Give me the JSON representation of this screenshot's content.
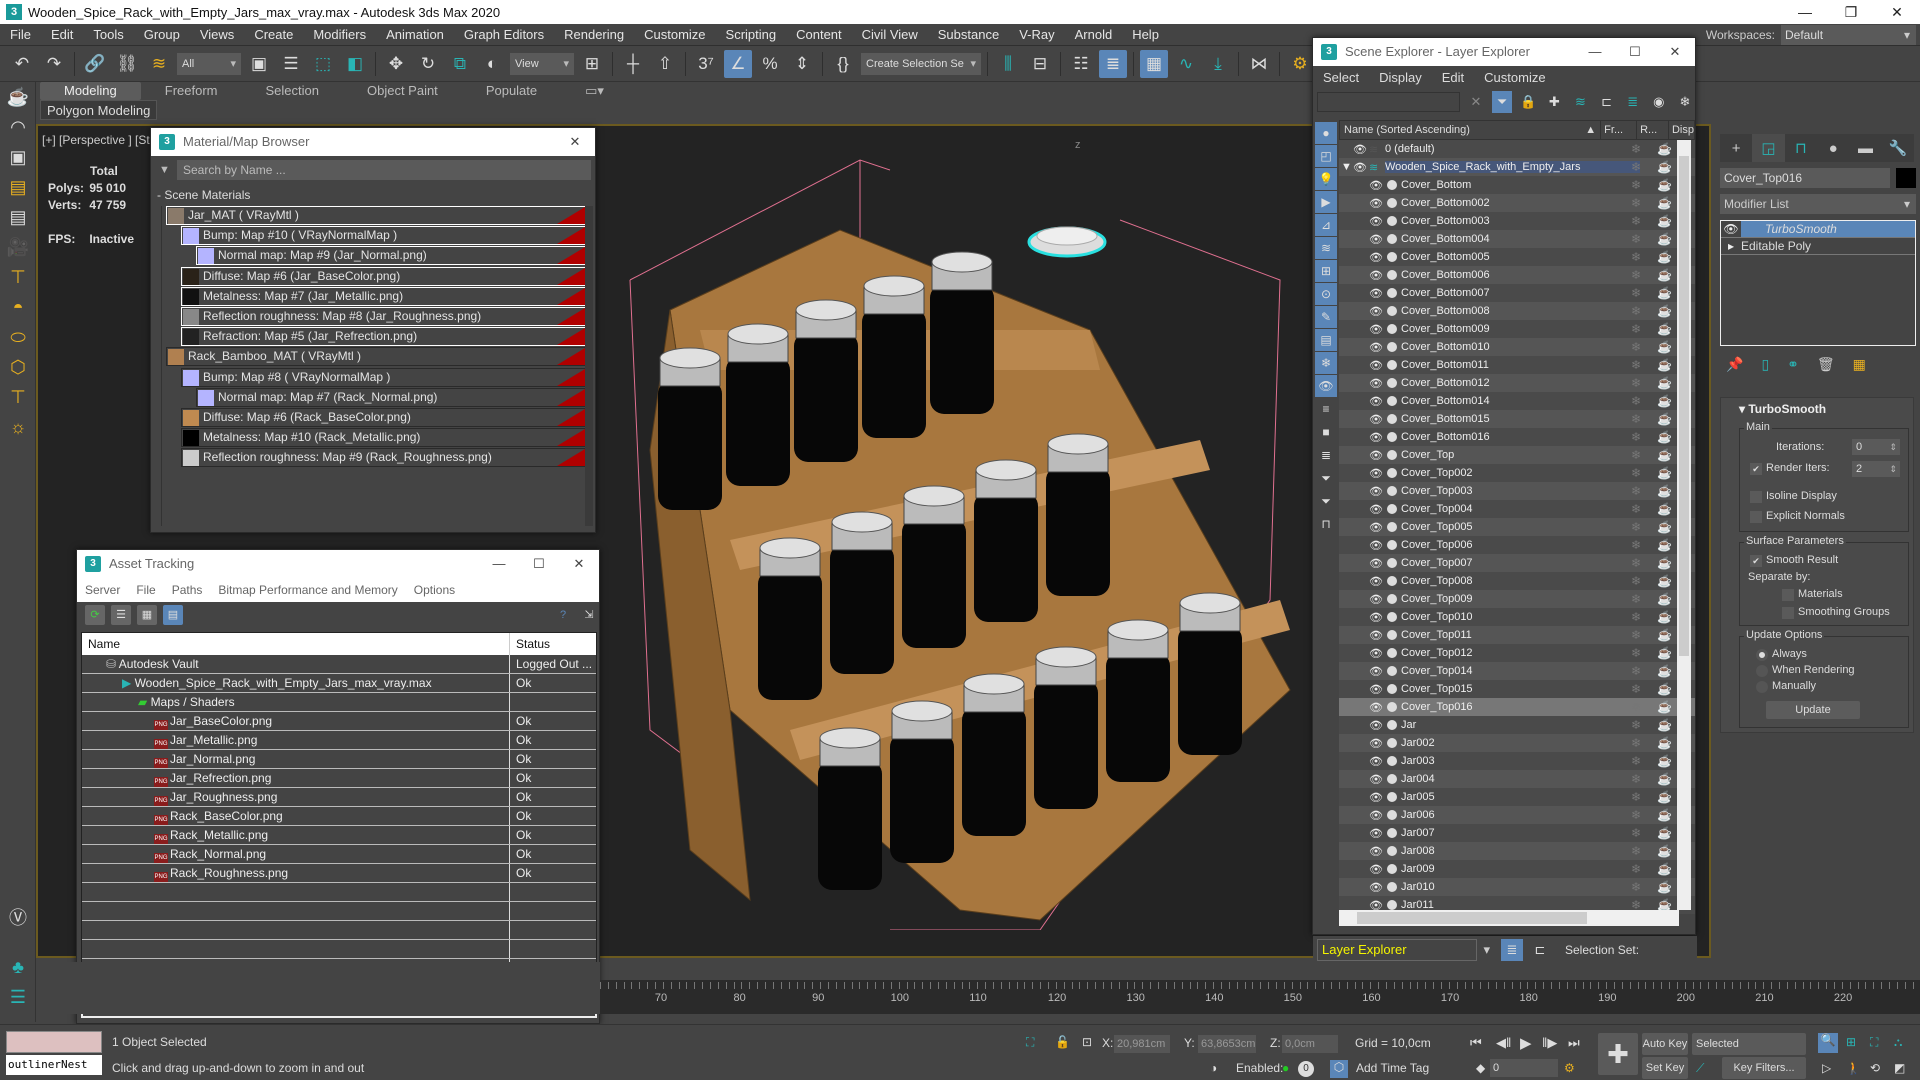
{
  "window": {
    "title": "Wooden_Spice_Rack_with_Empty_Jars_max_vray.max - Autodesk 3ds Max 2020",
    "minimize": "—",
    "restore": "❐",
    "close": "✕"
  },
  "menubar": [
    "File",
    "Edit",
    "Tools",
    "Group",
    "Views",
    "Create",
    "Modifiers",
    "Animation",
    "Graph Editors",
    "Rendering",
    "Customize",
    "Scripting",
    "Content",
    "Civil View",
    "Substance",
    "V-Ray",
    "Arnold",
    "Help"
  ],
  "workspaces": {
    "label": "Workspaces:",
    "value": "Default"
  },
  "toolbar": {
    "selection_filter": "All",
    "ref_coord": "View",
    "named_selection": "Create Selection Se"
  },
  "ribbon": {
    "tabs": [
      "Modeling",
      "Freeform",
      "Selection",
      "Object Paint",
      "Populate"
    ],
    "active_tab": "Modeling",
    "panel": "Polygon Modeling"
  },
  "viewport": {
    "label": "[+] [Perspective ] [St",
    "stats": {
      "total_label": "Total",
      "polys_label": "Polys:",
      "polys": "95 010",
      "verts_label": "Verts:",
      "verts": "47 759",
      "fps_label": "FPS:",
      "fps": "Inactive"
    },
    "axis_label": "z"
  },
  "material_browser": {
    "title": "Material/Map Browser",
    "search_placeholder": "Search by Name ...",
    "section": "- Scene Materials",
    "items": [
      {
        "text": "Jar_MAT  ( VRayMtl )",
        "level": 0,
        "swatch": "#8a7a6a",
        "highlight": true
      },
      {
        "text": "Bump: Map #10  ( VRayNormalMap )",
        "level": 1,
        "swatch": "#b4b4ff",
        "highlight": true
      },
      {
        "text": "Normal map: Map #9 (Jar_Normal.png)",
        "level": 2,
        "swatch": "#b4b4ff",
        "highlight": true
      },
      {
        "text": "Diffuse: Map #6 (Jar_BaseColor.png)",
        "level": 1,
        "swatch": "#2a2218",
        "highlight": true
      },
      {
        "text": "Metalness: Map #7 (Jar_Metallic.png)",
        "level": 1,
        "swatch": "#111111",
        "highlight": true
      },
      {
        "text": "Reflection roughness: Map #8 (Jar_Roughness.png)",
        "level": 1,
        "swatch": "#888888",
        "highlight": true
      },
      {
        "text": "Refraction: Map #5 (Jar_Refrection.png)",
        "level": 1,
        "swatch": "#222222",
        "highlight": true
      },
      {
        "text": "Rack_Bamboo_MAT  ( VRayMtl )",
        "level": 0,
        "swatch": "#b08050",
        "highlight": false
      },
      {
        "text": "Bump: Map #8  ( VRayNormalMap )",
        "level": 1,
        "swatch": "#b4b4ff",
        "highlight": false
      },
      {
        "text": "Normal map: Map #7 (Rack_Normal.png)",
        "level": 2,
        "swatch": "#b4b4ff",
        "highlight": false
      },
      {
        "text": "Diffuse: Map #6 (Rack_BaseColor.png)",
        "level": 1,
        "swatch": "#c08a50",
        "highlight": false
      },
      {
        "text": "Metalness: Map #10 (Rack_Metallic.png)",
        "level": 1,
        "swatch": "#000000",
        "highlight": false
      },
      {
        "text": "Reflection roughness: Map #9 (Rack_Roughness.png)",
        "level": 1,
        "swatch": "#cccccc",
        "highlight": false
      }
    ]
  },
  "asset_tracking": {
    "title": "Asset Tracking",
    "menu": [
      "Server",
      "File",
      "Paths",
      "Bitmap Performance and Memory",
      "Options"
    ],
    "columns": [
      "Name",
      "Status"
    ],
    "rows": [
      {
        "name": "Autodesk Vault",
        "status": "Logged Out ...",
        "level": 0,
        "icon": "vault"
      },
      {
        "name": "Wooden_Spice_Rack_with_Empty_Jars_max_vray.max",
        "status": "Ok",
        "level": 1,
        "icon": "max"
      },
      {
        "name": "Maps / Shaders",
        "status": "",
        "level": 2,
        "icon": "maps"
      },
      {
        "name": "Jar_BaseColor.png",
        "status": "Ok",
        "level": 3,
        "icon": "png"
      },
      {
        "name": "Jar_Metallic.png",
        "status": "Ok",
        "level": 3,
        "icon": "png"
      },
      {
        "name": "Jar_Normal.png",
        "status": "Ok",
        "level": 3,
        "icon": "png"
      },
      {
        "name": "Jar_Refrection.png",
        "status": "Ok",
        "level": 3,
        "icon": "png"
      },
      {
        "name": "Jar_Roughness.png",
        "status": "Ok",
        "level": 3,
        "icon": "png"
      },
      {
        "name": "Rack_BaseColor.png",
        "status": "Ok",
        "level": 3,
        "icon": "png"
      },
      {
        "name": "Rack_Metallic.png",
        "status": "Ok",
        "level": 3,
        "icon": "png"
      },
      {
        "name": "Rack_Normal.png",
        "status": "Ok",
        "level": 3,
        "icon": "png"
      },
      {
        "name": "Rack_Roughness.png",
        "status": "Ok",
        "level": 3,
        "icon": "png"
      }
    ],
    "png_badge": "PNG"
  },
  "scene_explorer": {
    "title": "Scene Explorer - Layer Explorer",
    "menu": [
      "Select",
      "Display",
      "Edit",
      "Customize"
    ],
    "columns": {
      "name": "Name (Sorted Ascending)",
      "frozen": "Fr...",
      "render": "R...",
      "display": "Disp"
    },
    "layers": [
      {
        "name": "0 (default)"
      },
      {
        "name": "Wooden_Spice_Rack_with_Empty_Jars"
      }
    ],
    "objects": [
      "Cover_Bottom",
      "Cover_Bottom002",
      "Cover_Bottom003",
      "Cover_Bottom004",
      "Cover_Bottom005",
      "Cover_Bottom006",
      "Cover_Bottom007",
      "Cover_Bottom008",
      "Cover_Bottom009",
      "Cover_Bottom010",
      "Cover_Bottom011",
      "Cover_Bottom012",
      "Cover_Bottom014",
      "Cover_Bottom015",
      "Cover_Bottom016",
      "Cover_Top",
      "Cover_Top002",
      "Cover_Top003",
      "Cover_Top004",
      "Cover_Top005",
      "Cover_Top006",
      "Cover_Top007",
      "Cover_Top008",
      "Cover_Top009",
      "Cover_Top010",
      "Cover_Top011",
      "Cover_Top012",
      "Cover_Top014",
      "Cover_Top015",
      "Cover_Top016",
      "Jar",
      "Jar002",
      "Jar003",
      "Jar004",
      "Jar005",
      "Jar006",
      "Jar007",
      "Jar008",
      "Jar009",
      "Jar010",
      "Jar011"
    ],
    "selected_object": "Cover_Top016",
    "footer": {
      "explorer": "Layer Explorer",
      "selection_set_label": "Selection Set:"
    }
  },
  "command_panel": {
    "object_name": "Cover_Top016",
    "modifier_list": "Modifier List",
    "stack": [
      {
        "name": "TurboSmooth",
        "selected": true
      },
      {
        "name": "Editable Poly",
        "selected": false
      }
    ],
    "rollout": {
      "title": "TurboSmooth",
      "main_group": "Main",
      "iterations_label": "Iterations:",
      "iterations": "0",
      "render_iters_label": "Render Iters:",
      "render_iters": "2",
      "render_iters_checked": true,
      "isoline_label": "Isoline Display",
      "isoline_checked": false,
      "explicit_normals_label": "Explicit Normals",
      "explicit_normals_checked": false,
      "surface_group": "Surface Parameters",
      "smooth_result_label": "Smooth Result",
      "smooth_result_checked": true,
      "separate_by_label": "Separate by:",
      "materials_label": "Materials",
      "smoothing_groups_label": "Smoothing Groups",
      "update_group": "Update Options",
      "update_options": [
        "Always",
        "When Rendering",
        "Manually"
      ],
      "update_selected": "Always",
      "update_button": "Update"
    }
  },
  "timeline": {
    "ticks": [
      70,
      80,
      90,
      100,
      110,
      120,
      130,
      140,
      150,
      160,
      170,
      180,
      190,
      200,
      210,
      220
    ]
  },
  "status": {
    "maxscript_listener": "outlinerNest",
    "selection": "1 Object Selected",
    "prompt": "Click and drag up-and-down to zoom in and out",
    "x_label": "X:",
    "x": "20,981cm",
    "y_label": "Y:",
    "y": "63,8653cm",
    "z_label": "Z:",
    "z": "0,0cm",
    "grid": "Grid = 10,0cm",
    "enabled_label": "Enabled:",
    "add_time_tag": "Add Time Tag",
    "auto_key": "Auto Key",
    "set_key": "Set Key",
    "key_mode": "Selected",
    "key_filters": "Key Filters...",
    "frame": "0"
  }
}
